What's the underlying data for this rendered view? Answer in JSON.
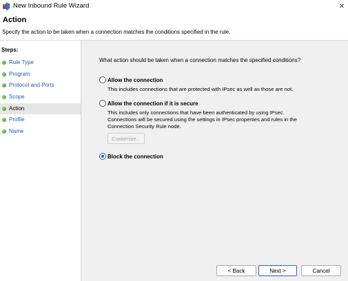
{
  "window": {
    "title": "New Inbound Rule Wizard",
    "close_glyph": "✕"
  },
  "header": {
    "title": "Action",
    "description": "Specify the action to be taken when a connection matches the conditions specified in the rule."
  },
  "steps": {
    "title": "Steps:",
    "items": [
      {
        "label": "Rule Type"
      },
      {
        "label": "Program"
      },
      {
        "label": "Protocol and Ports"
      },
      {
        "label": "Scope"
      },
      {
        "label": "Action"
      },
      {
        "label": "Profile"
      },
      {
        "label": "Name"
      }
    ],
    "active_index": 4
  },
  "main": {
    "question": "What action should be taken when a connection matches the specified conditions?",
    "options": [
      {
        "label": "Allow the connection",
        "description": "This includes connections that are protected with IPsec as well as those are not.",
        "selected": false
      },
      {
        "label": "Allow the connection if it is secure",
        "description": "This includes only connections that have been authenticated by using IPsec.  Connections will be secured using the settings in IPsec properties and rules in the Connection Security Rule node.",
        "selected": false
      },
      {
        "label": "Block the connection",
        "description": "",
        "selected": true
      }
    ],
    "customize_label": "Customize..."
  },
  "buttons": {
    "back": "< Back",
    "next": "Next >",
    "cancel": "Cancel"
  },
  "colors": {
    "accent": "#2a55c8",
    "step_link": "#1f5fbf",
    "step_dot": "#3a9a24"
  },
  "icons": {
    "app": "firewall-shield-icon",
    "close": "close-icon",
    "step": "green-dot-icon"
  }
}
